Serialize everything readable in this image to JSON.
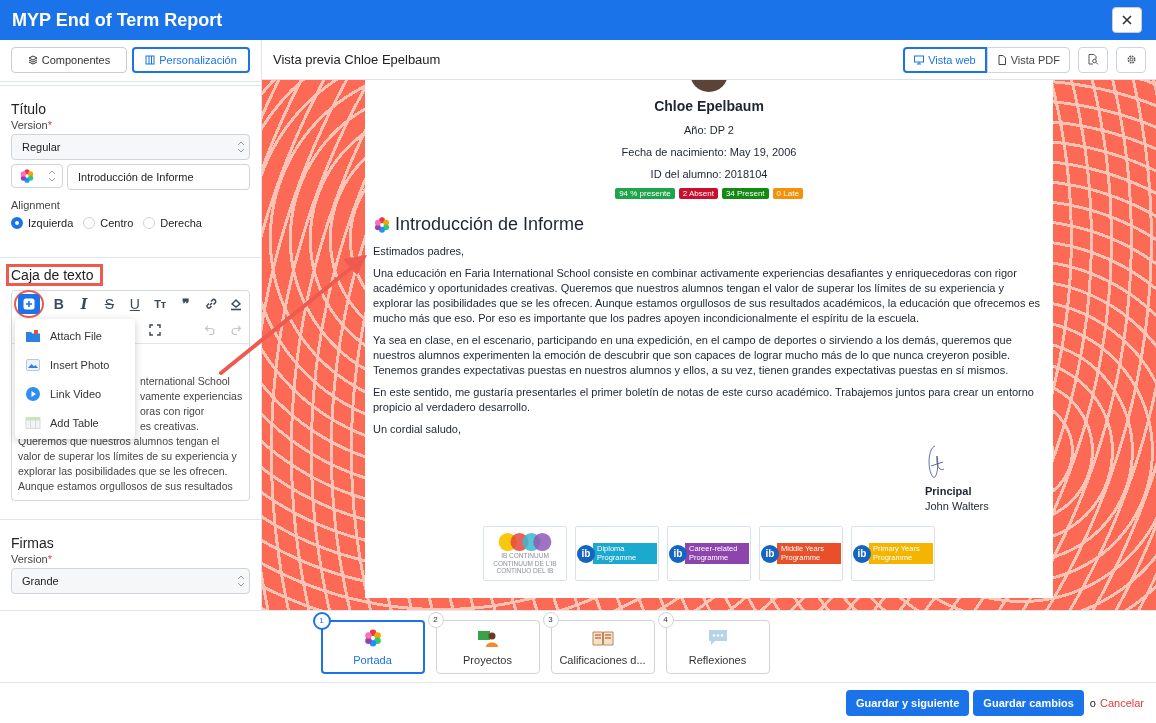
{
  "window": {
    "title": "MYP End of Term Report"
  },
  "sidebar_tabs": [
    {
      "label": "Componentes",
      "selected": false
    },
    {
      "label": "Personalización",
      "selected": true
    }
  ],
  "title_section": {
    "heading": "Título",
    "version_label": "Version",
    "required_mark": "*",
    "version_value": "Regular",
    "title_value": "Introducción de Informe",
    "alignment_label": "Alignment",
    "alignment_options": [
      {
        "label": "Izquierda",
        "selected": true
      },
      {
        "label": "Centro",
        "selected": false
      },
      {
        "label": "Derecha",
        "selected": false
      }
    ]
  },
  "text_box": {
    "heading": "Caja de texto",
    "toolbar": [
      {
        "kind": "insert",
        "selected": true,
        "disabled": false
      },
      {
        "kind": "bold",
        "glyph": "B",
        "selected": false,
        "disabled": false
      },
      {
        "kind": "italic",
        "glyph": "I",
        "selected": false,
        "disabled": false
      },
      {
        "kind": "strike",
        "glyph": "S",
        "selected": false,
        "disabled": false
      },
      {
        "kind": "underline",
        "glyph": "U",
        "selected": false,
        "disabled": false
      },
      {
        "kind": "size",
        "glyph": "Tт",
        "selected": false,
        "disabled": false
      },
      {
        "kind": "quote",
        "glyph": "❞",
        "selected": false,
        "disabled": false
      },
      {
        "kind": "link",
        "selected": false,
        "disabled": false
      },
      {
        "kind": "format",
        "selected": false,
        "disabled": false
      },
      {
        "kind": "fullscreen",
        "selected": false,
        "disabled": false
      },
      {
        "kind": "undo",
        "selected": false,
        "disabled": true
      },
      {
        "kind": "redo",
        "selected": false,
        "disabled": true
      }
    ],
    "menu": [
      "Attach File",
      "Insert Photo",
      "Link Video",
      "Add Table"
    ],
    "body_fragments": [
      "nternational School",
      "vamente experiencias",
      "oras con rigor",
      "es creativas."
    ],
    "body_lines": [
      "Queremos que nuestros alumnos tengan el",
      "valor de superar los límites de su experiencia y",
      "explorar las posibilidades que se les ofrecen.",
      "Aunque estamos orgullosos de sus resultados"
    ]
  },
  "signatures_section": {
    "heading": "Firmas",
    "version_label": "Version",
    "required_mark": "*",
    "version_value": "Grande"
  },
  "preview": {
    "title": "Vista previa Chloe Epelbaum",
    "view_buttons": [
      {
        "label": "Vista web",
        "selected": true
      },
      {
        "label": "Vista PDF",
        "selected": false
      }
    ]
  },
  "student": {
    "name": "Chloe Epelbaum",
    "details": [
      "Año: DP 2",
      "Fecha de nacimiento: May 19, 2006",
      "ID del alumno: 2018104"
    ],
    "badges": [
      {
        "label": "94 % presente",
        "color": "#1ea44b"
      },
      {
        "label": "2 Absent",
        "color": "#c8102e"
      },
      {
        "label": "34 Present",
        "color": "#138a13"
      },
      {
        "label": "0 Late",
        "color": "#f5900b"
      }
    ]
  },
  "report": {
    "heading": "Introducción de Informe",
    "paragraphs": [
      "Estimados padres,",
      "Una educación en Faria International School consiste en combinar activamente experiencias desafiantes y enriquecedoras con rigor académico y oportunidades creativas. Queremos que nuestros alumnos tengan el valor de superar los límites de su experiencia y explorar las posibilidades que se les ofrecen. Aunque estamos orgullosos de sus resultados académicos, la educación que ofrecemos es mucho más que eso. Por eso es importante que los padres apoyen incondicionalmente el espíritu de la escuela.",
      "Ya sea en clase, en el escenario, participando en una expedición, en el campo de deportes o sirviendo a los demás, queremos que nuestros alumnos experimenten la emoción de descubrir que son capaces de lograr mucho más de lo que nunca creyeron posible. Tenemos grandes expectativas puestas en nuestros alumnos y ellos, a su vez, tienen grandes expectativas puestas en sí mismos.",
      "En este sentido, me gustaría presentarles el primer boletín de notas de este curso académico. Trabajemos juntos para crear un entorno propicio al verdadero desarrollo.",
      "Un cordial saludo,"
    ],
    "signer_role": "Principal",
    "signer_name": "John Walters"
  },
  "logos": [
    {
      "kind": "continuum",
      "lines": [
        "IB CONTINUUM",
        "CONTINUUM DE L'IB",
        "CONTINUO DEL IB"
      ]
    },
    {
      "kind": "programme",
      "mark": "ib",
      "lines": [
        "Diploma",
        "Programme"
      ],
      "color": "#1ba9d0"
    },
    {
      "kind": "programme",
      "mark": "ib",
      "lines": [
        "Career-related",
        "Programme"
      ],
      "color": "#8e44ad"
    },
    {
      "kind": "programme",
      "mark": "ib",
      "lines": [
        "Middle Years",
        "Programme"
      ],
      "color": "#e8502a"
    },
    {
      "kind": "programme",
      "mark": "ib",
      "lines": [
        "Primary Years",
        "Programme"
      ],
      "color": "#f5b400"
    }
  ],
  "steps": [
    {
      "number": "1",
      "label": "Portada",
      "selected": true
    },
    {
      "number": "2",
      "label": "Proyectos",
      "selected": false
    },
    {
      "number": "3",
      "label": "Calificaciones d...",
      "selected": false
    },
    {
      "number": "4",
      "label": "Reflexiones",
      "selected": false
    }
  ],
  "footer": {
    "buttons": [
      "Guardar y siguiente",
      "Guardar cambios"
    ],
    "separator": "o",
    "cancel": "Cancelar"
  }
}
